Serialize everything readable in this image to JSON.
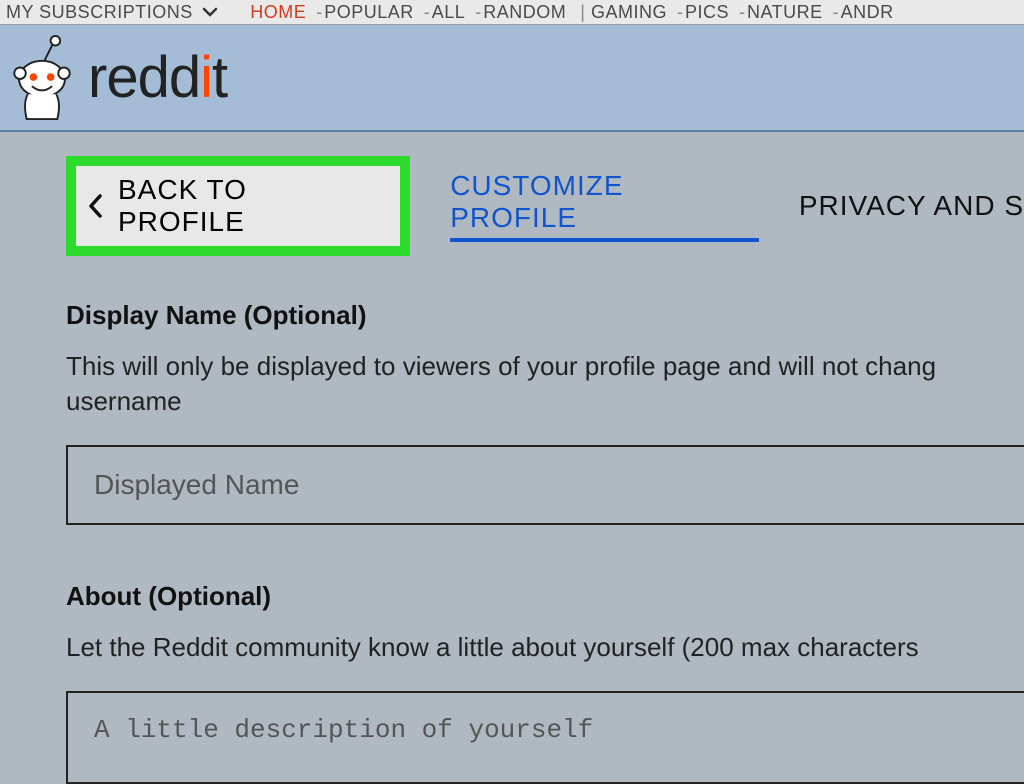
{
  "topnav": {
    "subscriptions": "MY SUBSCRIPTIONS",
    "home": "HOME",
    "popular": "POPULAR",
    "all": "ALL",
    "random": "RANDOM",
    "gaming": "GAMING",
    "pics": "PICS",
    "nature": "NATURE",
    "andr": "ANDR"
  },
  "brand": {
    "wordmark_pre": "redd",
    "wordmark_i": "i",
    "wordmark_post": "t"
  },
  "tabs": {
    "back": "BACK TO PROFILE",
    "customize": "CUSTOMIZE PROFILE",
    "privacy": "PRIVACY AND S"
  },
  "display_name": {
    "label": "Display Name (Optional)",
    "desc": "This will only be displayed to viewers of your profile page and will not chang username",
    "placeholder": "Displayed Name"
  },
  "about": {
    "label": "About (Optional)",
    "desc": "Let the Reddit community know a little about yourself (200 max characters",
    "placeholder": "A little description of yourself"
  }
}
